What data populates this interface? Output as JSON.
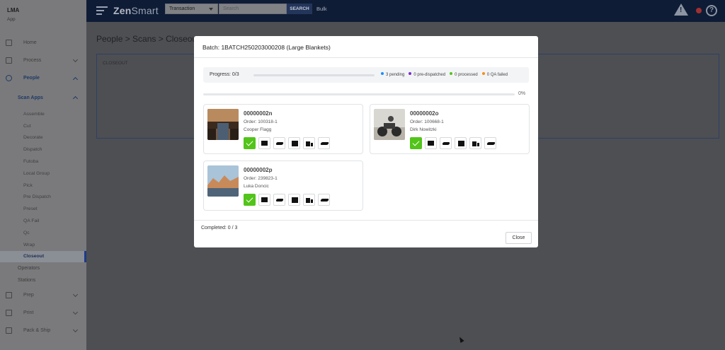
{
  "app": {
    "title": "LMA",
    "subtitle": "App"
  },
  "sidebar": {
    "items": [
      {
        "label": "Home"
      },
      {
        "label": "Process"
      },
      {
        "label": "People"
      },
      {
        "label": "Scan Apps"
      },
      {
        "label": "Assemble"
      },
      {
        "label": "Cut"
      },
      {
        "label": "Decorate"
      },
      {
        "label": "Dispatch"
      },
      {
        "label": "Futoba"
      },
      {
        "label": "Local Group"
      },
      {
        "label": "Pick"
      },
      {
        "label": "Pre Dispatch"
      },
      {
        "label": "Preset"
      },
      {
        "label": "QA Fail"
      },
      {
        "label": "Qc"
      },
      {
        "label": "Wrap"
      },
      {
        "label": "Closeout"
      },
      {
        "label": "Operators"
      },
      {
        "label": "Stations"
      },
      {
        "label": "Prep"
      },
      {
        "label": "Print"
      },
      {
        "label": "Pack & Ship"
      }
    ]
  },
  "header": {
    "logo_a": "Zen",
    "logo_b": "Smart",
    "select_value": "Transaction",
    "search_placeholder": "Search",
    "search_button": "SEARCH",
    "bulk": "Bulk",
    "help": "?"
  },
  "page": {
    "breadcrumb": "People > Scans > Closeout",
    "panel_label": "CLOSEOUT"
  },
  "modal": {
    "title": "Batch: 1BATCH250203000208 (Large Blankets)",
    "progress_label": "Progress: 0/3",
    "progress_fraction": 0,
    "legend": [
      {
        "label": "3 pending",
        "color": "#1890ff"
      },
      {
        "label": "0 pre-dispatched",
        "color": "#722ed1"
      },
      {
        "label": "0 processed",
        "color": "#52c41a"
      },
      {
        "label": "0 QA failed",
        "color": "#fa8c16"
      }
    ],
    "percent": "0%",
    "items": [
      {
        "id": "00000002n",
        "order": "Order: 100318-1",
        "customer": "Cooper Flagg"
      },
      {
        "id": "00000002o",
        "order": "Order: 100668-1",
        "customer": "Dirk Nowitzki"
      },
      {
        "id": "00000002p",
        "order": "Order: 239823-1",
        "customer": "Luka Doncic"
      }
    ],
    "completed": "Completed: 0 / 3",
    "close_button": "Close"
  }
}
